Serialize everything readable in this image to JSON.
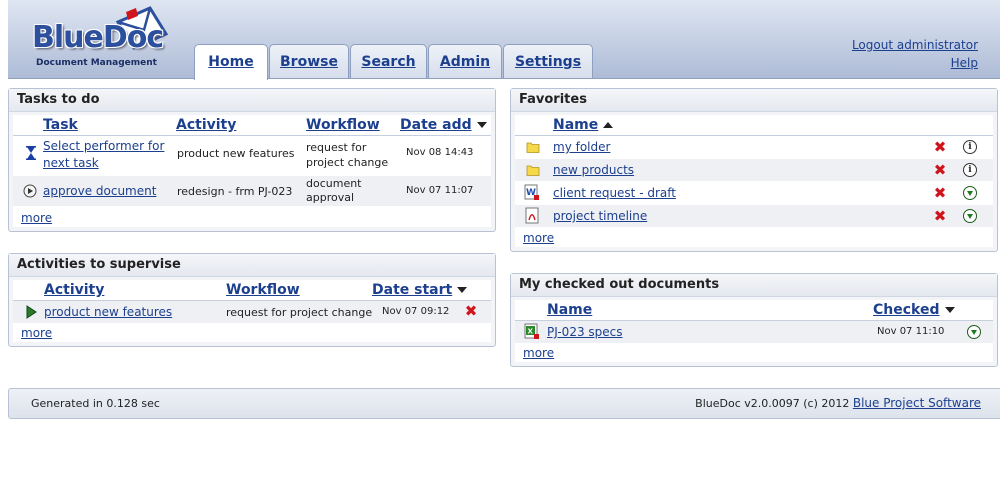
{
  "brand": {
    "logo_text": "BlueDoc",
    "logo_subtitle": "Document Management",
    "accent": "#1c3f8e"
  },
  "tabs": [
    {
      "label": "Home",
      "active": true
    },
    {
      "label": "Browse",
      "active": false
    },
    {
      "label": "Search",
      "active": false
    },
    {
      "label": "Admin",
      "active": false
    },
    {
      "label": "Settings",
      "active": false
    }
  ],
  "header_links": {
    "logout": "Logout administrator",
    "help": "Help"
  },
  "tasks": {
    "title": "Tasks to do",
    "columns": [
      "Task",
      "Activity",
      "Workflow",
      "Date add"
    ],
    "rows": [
      {
        "icon": "hourglass-icon",
        "task": "Select performer for next task",
        "activity": "product new features",
        "workflow": "request for project change",
        "date": "Nov 08 14:43"
      },
      {
        "icon": "play-circle-icon",
        "task": "approve document",
        "activity": "redesign - frm PJ-023",
        "workflow": "document approval",
        "date": "Nov 07 11:07"
      }
    ],
    "more": "more"
  },
  "supervise": {
    "title": "Activities to supervise",
    "columns": [
      "Activity",
      "Workflow",
      "Date start"
    ],
    "rows": [
      {
        "icon": "play-arrow-icon",
        "activity": "product new features",
        "workflow": "request for project change",
        "date": "Nov 07 09:12"
      }
    ],
    "more": "more"
  },
  "favorites": {
    "title": "Favorites",
    "columns": [
      "Name"
    ],
    "rows": [
      {
        "icon": "folder-icon",
        "name": "my folder",
        "action": "info-icon"
      },
      {
        "icon": "folder-icon",
        "name": "new products",
        "action": "info-icon"
      },
      {
        "icon": "word-doc-locked-icon",
        "name": "client request - draft",
        "action": "download-icon"
      },
      {
        "icon": "pdf-icon",
        "name": "project timeline",
        "action": "download-icon"
      }
    ],
    "more": "more"
  },
  "checked_out": {
    "title": "My checked out documents",
    "columns": [
      "Name",
      "Checked"
    ],
    "rows": [
      {
        "icon": "excel-doc-locked-icon",
        "name": "PJ-023 specs",
        "date": "Nov 07 11:10"
      }
    ],
    "more": "more"
  },
  "footer": {
    "generated": "Generated in 0.128 sec",
    "version": "BlueDoc v2.0.0097 (c) 2012",
    "company": "Blue Project Software"
  }
}
